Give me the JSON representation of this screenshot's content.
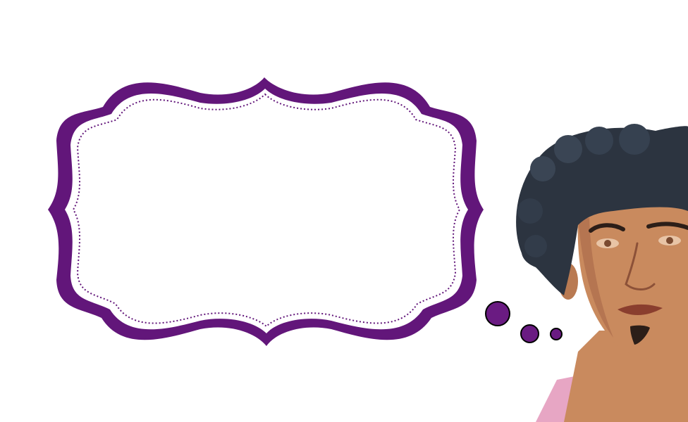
{
  "canvas": {
    "background_color": "#ffffff"
  },
  "frame": {
    "shape": "decorative-scalloped-label",
    "outer_color": "#62167a",
    "inner_fill": "#ffffff",
    "dotted_border_color": "#62167a",
    "text": ""
  },
  "thought_bubbles": {
    "count": 3,
    "fill_color": "#6a1b82",
    "outline_color": "#000000"
  },
  "character": {
    "description_icon": "man-portrait-icon",
    "hair_color": "#2c3440",
    "skin_color": "#c98a5e",
    "shirt_color": "#e7a6c4"
  }
}
